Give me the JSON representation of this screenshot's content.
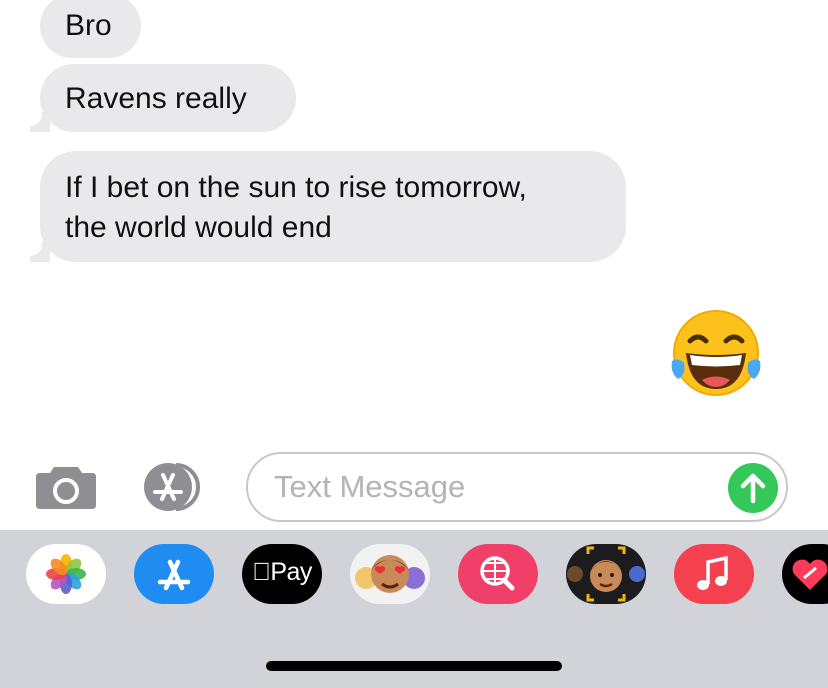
{
  "messages": [
    {
      "text": "Bro"
    },
    {
      "text": "Ravens really"
    },
    {
      "text": "If I bet on the sun to rise tomorrow,\nthe world would end"
    }
  ],
  "emoji_message": {
    "icon": "face-with-tears-of-joy"
  },
  "input": {
    "placeholder": "Text Message"
  },
  "toolbar": {
    "camera_icon": "camera-icon",
    "apps_icon": "app-store-icon"
  },
  "drawer": {
    "apps": [
      {
        "name": "Photos",
        "icon": "photos-icon"
      },
      {
        "name": "App Store",
        "icon": "app-store-icon"
      },
      {
        "name": "Apple Pay",
        "label": "Pay",
        "icon": "apple-logo"
      },
      {
        "name": "Memoji Stickers",
        "icon": "memoji-icon"
      },
      {
        "name": "Images Search",
        "icon": "globe-search-icon"
      },
      {
        "name": "Memoji",
        "icon": "memoji-icon"
      },
      {
        "name": "Music",
        "icon": "music-note-icon"
      },
      {
        "name": "Digital Touch",
        "icon": "heart-icon"
      }
    ]
  },
  "colors": {
    "received_bubble": "#e9e9eb",
    "send_button": "#34c759",
    "drawer_background": "#d1d3d9"
  }
}
